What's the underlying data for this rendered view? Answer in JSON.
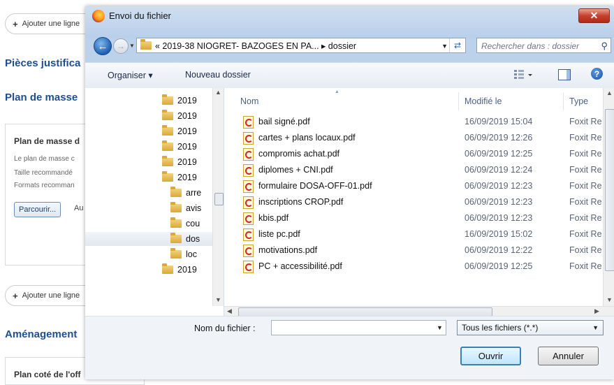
{
  "background": {
    "add_line_label": "Ajouter une ligne",
    "section1": "Pièces justifica",
    "section2": "Plan de masse",
    "card1": {
      "title": "Plan de masse d",
      "line1": "Le plan de masse c",
      "line2": "Taille recommandé",
      "line3": "Formats recomman",
      "browse_label": "Parcourir...",
      "browse_after": "Au"
    },
    "section3": "Aménagement",
    "card2_title": "Plan coté de l'off"
  },
  "dialog": {
    "title": "Envoi du fichier",
    "close_label": "✕",
    "address_path": "« 2019-38 NIOGRET- BAZOGES EN PA...  ▸  dossier",
    "search_placeholder": "Rechercher dans : dossier",
    "toolbar": {
      "organize": "Organiser ▾",
      "new_folder": "Nouveau dossier"
    },
    "tree": [
      {
        "label": "2019",
        "indent": 0,
        "selected": false
      },
      {
        "label": "2019",
        "indent": 0,
        "selected": false
      },
      {
        "label": "2019",
        "indent": 0,
        "selected": false
      },
      {
        "label": "2019",
        "indent": 0,
        "selected": false
      },
      {
        "label": "2019",
        "indent": 0,
        "selected": false
      },
      {
        "label": "2019",
        "indent": 0,
        "selected": false
      },
      {
        "label": "arre",
        "indent": 1,
        "selected": false
      },
      {
        "label": "avis",
        "indent": 1,
        "selected": false
      },
      {
        "label": "cou",
        "indent": 1,
        "selected": false
      },
      {
        "label": "dos",
        "indent": 1,
        "selected": true
      },
      {
        "label": "loc",
        "indent": 1,
        "selected": false
      },
      {
        "label": "2019",
        "indent": 0,
        "selected": false
      }
    ],
    "columns": {
      "name": "Nom",
      "modified": "Modifié le",
      "type": "Type"
    },
    "files": [
      {
        "name": "bail signé.pdf",
        "modified": "16/09/2019 15:04",
        "type": "Foxit Re"
      },
      {
        "name": "cartes + plans locaux.pdf",
        "modified": "06/09/2019 12:26",
        "type": "Foxit Re"
      },
      {
        "name": "compromis achat.pdf",
        "modified": "06/09/2019 12:25",
        "type": "Foxit Re"
      },
      {
        "name": "diplomes + CNI.pdf",
        "modified": "06/09/2019 12:24",
        "type": "Foxit Re"
      },
      {
        "name": "formulaire DOSA-OFF-01.pdf",
        "modified": "06/09/2019 12:23",
        "type": "Foxit Re"
      },
      {
        "name": "inscriptions CROP.pdf",
        "modified": "06/09/2019 12:23",
        "type": "Foxit Re"
      },
      {
        "name": "kbis.pdf",
        "modified": "06/09/2019 12:23",
        "type": "Foxit Re"
      },
      {
        "name": "liste pc.pdf",
        "modified": "16/09/2019 15:02",
        "type": "Foxit Re"
      },
      {
        "name": "motivations.pdf",
        "modified": "06/09/2019 12:22",
        "type": "Foxit Re"
      },
      {
        "name": "PC + accessibilité.pdf",
        "modified": "06/09/2019 12:25",
        "type": "Foxit Re"
      }
    ],
    "filename_label": "Nom du fichier :",
    "filename_value": "",
    "filetype_selected": "Tous les fichiers (*.*)",
    "open_label": "Ouvrir",
    "cancel_label": "Annuler",
    "colors": {
      "accent": "#1f4f8f",
      "close": "#c7412d",
      "selection": "#e2e8f0"
    }
  }
}
